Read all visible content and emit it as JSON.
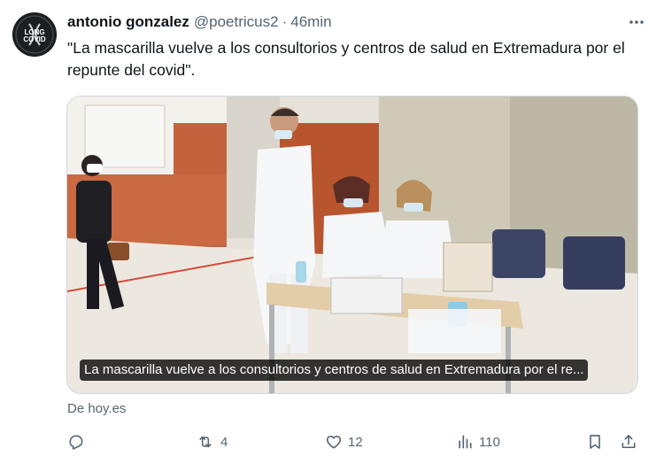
{
  "tweet": {
    "avatar_text": [
      "LONG",
      "COVID"
    ],
    "author_name": "antonio gonzalez",
    "handle": "@poetricus2",
    "separator": "·",
    "time": "46min",
    "text": "\"La mascarilla vuelve a los consultorios y centros de salud en Extremadura por el repunte del covid\".",
    "more_icon": "more-horizontal-icon"
  },
  "media": {
    "caption": "La mascarilla vuelve a los consultorios y centros de salud en Extremadura por el re..."
  },
  "card_source": "De hoy.es",
  "actions": {
    "reply": {
      "icon": "reply-icon",
      "count": ""
    },
    "retweet": {
      "icon": "retweet-icon",
      "count": "4"
    },
    "like": {
      "icon": "heart-icon",
      "count": "12"
    },
    "views": {
      "icon": "views-icon",
      "count": "110"
    },
    "bookmark": {
      "icon": "bookmark-icon"
    },
    "share": {
      "icon": "share-icon"
    }
  },
  "colors": {
    "text_primary": "#0f1419",
    "text_secondary": "#536471",
    "border": "#cfd9de"
  }
}
